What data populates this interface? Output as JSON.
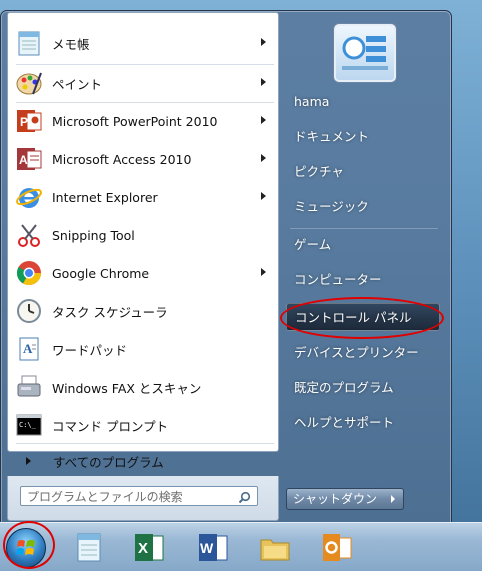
{
  "programs": [
    {
      "label": "メモ帳",
      "icon": "notepad-icon",
      "submenu": true
    },
    {
      "label": "ペイント",
      "icon": "paint-palette-icon",
      "submenu": true
    },
    {
      "label": "Microsoft PowerPoint 2010",
      "icon": "powerpoint-icon",
      "submenu": true
    },
    {
      "label": "Microsoft Access 2010",
      "icon": "access-icon",
      "submenu": true
    },
    {
      "label": "Internet Explorer",
      "icon": "internet-explorer-icon",
      "submenu": true
    },
    {
      "label": "Snipping Tool",
      "icon": "scissors-icon",
      "submenu": false
    },
    {
      "label": "Google Chrome",
      "icon": "chrome-icon",
      "submenu": true
    },
    {
      "label": "タスク スケジューラ",
      "icon": "clock-icon",
      "submenu": false
    },
    {
      "label": "ワードパッド",
      "icon": "wordpad-icon",
      "submenu": false
    },
    {
      "label": "Windows FAX とスキャン",
      "icon": "fax-icon",
      "submenu": false
    },
    {
      "label": "コマンド プロンプト",
      "icon": "command-prompt-icon",
      "submenu": false
    }
  ],
  "all_programs_label": "すべてのプログラム",
  "search_placeholder": "プログラムとファイルの検索",
  "right_items": [
    {
      "label": "hama"
    },
    {
      "label": "ドキュメント"
    },
    {
      "label": "ピクチャ"
    },
    {
      "label": "ミュージック"
    },
    {
      "label": "ゲーム"
    },
    {
      "label": "コンピューター"
    },
    {
      "label": "コントロール パネル",
      "highlighted": true
    },
    {
      "label": "デバイスとプリンター"
    },
    {
      "label": "既定のプログラム"
    },
    {
      "label": "ヘルプとサポート"
    }
  ],
  "shutdown_label": "シャットダウン",
  "taskbar_icons": [
    "notepad-icon",
    "excel-icon",
    "word-icon",
    "explorer-folder-icon",
    "outlook-icon"
  ],
  "colors": {
    "highlight_oval": "#e00000"
  }
}
